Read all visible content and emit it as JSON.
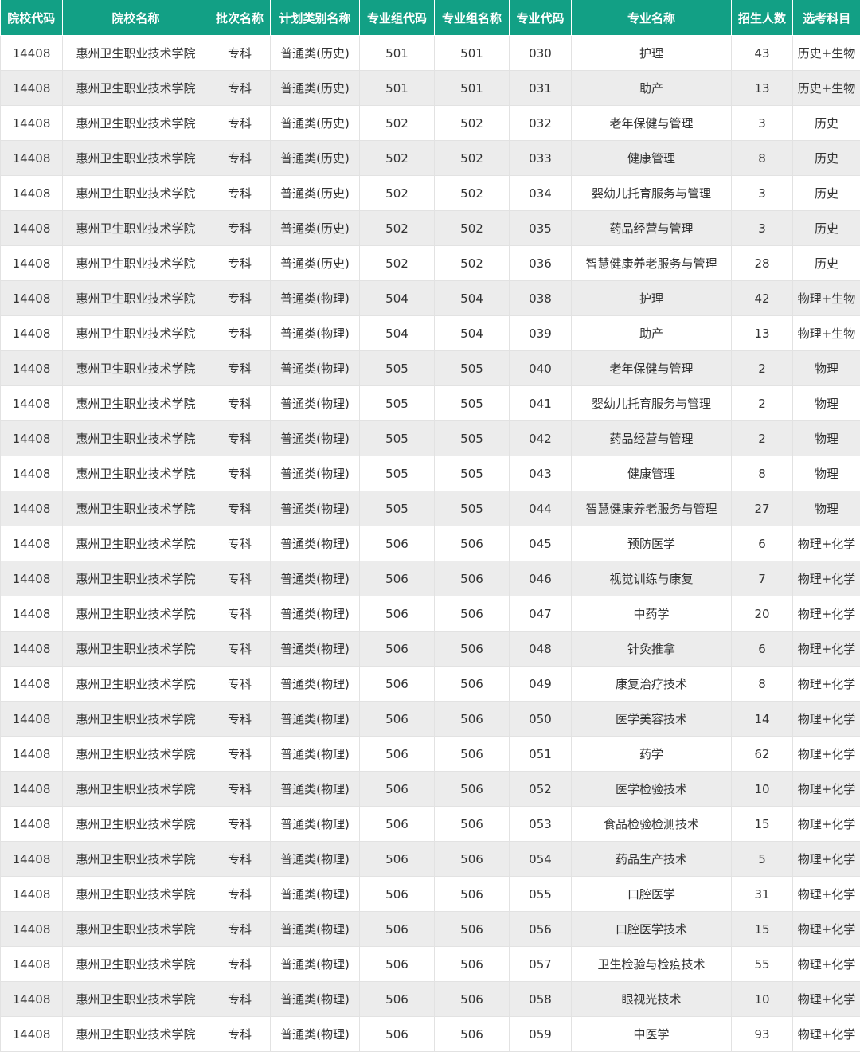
{
  "table": {
    "headers": [
      "院校代码",
      "院校名称",
      "批次名称",
      "计划类别名称",
      "专业组代码",
      "专业组名称",
      "专业代码",
      "专业名称",
      "招生人数",
      "选考科目"
    ],
    "rows": [
      [
        "14408",
        "惠州卫生职业技术学院",
        "专科",
        "普通类(历史)",
        "501",
        "501",
        "030",
        "护理",
        "43",
        "历史+生物"
      ],
      [
        "14408",
        "惠州卫生职业技术学院",
        "专科",
        "普通类(历史)",
        "501",
        "501",
        "031",
        "助产",
        "13",
        "历史+生物"
      ],
      [
        "14408",
        "惠州卫生职业技术学院",
        "专科",
        "普通类(历史)",
        "502",
        "502",
        "032",
        "老年保健与管理",
        "3",
        "历史"
      ],
      [
        "14408",
        "惠州卫生职业技术学院",
        "专科",
        "普通类(历史)",
        "502",
        "502",
        "033",
        "健康管理",
        "8",
        "历史"
      ],
      [
        "14408",
        "惠州卫生职业技术学院",
        "专科",
        "普通类(历史)",
        "502",
        "502",
        "034",
        "婴幼儿托育服务与管理",
        "3",
        "历史"
      ],
      [
        "14408",
        "惠州卫生职业技术学院",
        "专科",
        "普通类(历史)",
        "502",
        "502",
        "035",
        "药品经营与管理",
        "3",
        "历史"
      ],
      [
        "14408",
        "惠州卫生职业技术学院",
        "专科",
        "普通类(历史)",
        "502",
        "502",
        "036",
        "智慧健康养老服务与管理",
        "28",
        "历史"
      ],
      [
        "14408",
        "惠州卫生职业技术学院",
        "专科",
        "普通类(物理)",
        "504",
        "504",
        "038",
        "护理",
        "42",
        "物理+生物"
      ],
      [
        "14408",
        "惠州卫生职业技术学院",
        "专科",
        "普通类(物理)",
        "504",
        "504",
        "039",
        "助产",
        "13",
        "物理+生物"
      ],
      [
        "14408",
        "惠州卫生职业技术学院",
        "专科",
        "普通类(物理)",
        "505",
        "505",
        "040",
        "老年保健与管理",
        "2",
        "物理"
      ],
      [
        "14408",
        "惠州卫生职业技术学院",
        "专科",
        "普通类(物理)",
        "505",
        "505",
        "041",
        "婴幼儿托育服务与管理",
        "2",
        "物理"
      ],
      [
        "14408",
        "惠州卫生职业技术学院",
        "专科",
        "普通类(物理)",
        "505",
        "505",
        "042",
        "药品经营与管理",
        "2",
        "物理"
      ],
      [
        "14408",
        "惠州卫生职业技术学院",
        "专科",
        "普通类(物理)",
        "505",
        "505",
        "043",
        "健康管理",
        "8",
        "物理"
      ],
      [
        "14408",
        "惠州卫生职业技术学院",
        "专科",
        "普通类(物理)",
        "505",
        "505",
        "044",
        "智慧健康养老服务与管理",
        "27",
        "物理"
      ],
      [
        "14408",
        "惠州卫生职业技术学院",
        "专科",
        "普通类(物理)",
        "506",
        "506",
        "045",
        "预防医学",
        "6",
        "物理+化学"
      ],
      [
        "14408",
        "惠州卫生职业技术学院",
        "专科",
        "普通类(物理)",
        "506",
        "506",
        "046",
        "视觉训练与康复",
        "7",
        "物理+化学"
      ],
      [
        "14408",
        "惠州卫生职业技术学院",
        "专科",
        "普通类(物理)",
        "506",
        "506",
        "047",
        "中药学",
        "20",
        "物理+化学"
      ],
      [
        "14408",
        "惠州卫生职业技术学院",
        "专科",
        "普通类(物理)",
        "506",
        "506",
        "048",
        "针灸推拿",
        "6",
        "物理+化学"
      ],
      [
        "14408",
        "惠州卫生职业技术学院",
        "专科",
        "普通类(物理)",
        "506",
        "506",
        "049",
        "康复治疗技术",
        "8",
        "物理+化学"
      ],
      [
        "14408",
        "惠州卫生职业技术学院",
        "专科",
        "普通类(物理)",
        "506",
        "506",
        "050",
        "医学美容技术",
        "14",
        "物理+化学"
      ],
      [
        "14408",
        "惠州卫生职业技术学院",
        "专科",
        "普通类(物理)",
        "506",
        "506",
        "051",
        "药学",
        "62",
        "物理+化学"
      ],
      [
        "14408",
        "惠州卫生职业技术学院",
        "专科",
        "普通类(物理)",
        "506",
        "506",
        "052",
        "医学检验技术",
        "10",
        "物理+化学"
      ],
      [
        "14408",
        "惠州卫生职业技术学院",
        "专科",
        "普通类(物理)",
        "506",
        "506",
        "053",
        "食品检验检测技术",
        "15",
        "物理+化学"
      ],
      [
        "14408",
        "惠州卫生职业技术学院",
        "专科",
        "普通类(物理)",
        "506",
        "506",
        "054",
        "药品生产技术",
        "5",
        "物理+化学"
      ],
      [
        "14408",
        "惠州卫生职业技术学院",
        "专科",
        "普通类(物理)",
        "506",
        "506",
        "055",
        "口腔医学",
        "31",
        "物理+化学"
      ],
      [
        "14408",
        "惠州卫生职业技术学院",
        "专科",
        "普通类(物理)",
        "506",
        "506",
        "056",
        "口腔医学技术",
        "15",
        "物理+化学"
      ],
      [
        "14408",
        "惠州卫生职业技术学院",
        "专科",
        "普通类(物理)",
        "506",
        "506",
        "057",
        "卫生检验与检疫技术",
        "55",
        "物理+化学"
      ],
      [
        "14408",
        "惠州卫生职业技术学院",
        "专科",
        "普通类(物理)",
        "506",
        "506",
        "058",
        "眼视光技术",
        "10",
        "物理+化学"
      ],
      [
        "14408",
        "惠州卫生职业技术学院",
        "专科",
        "普通类(物理)",
        "506",
        "506",
        "059",
        "中医学",
        "93",
        "物理+化学"
      ]
    ]
  },
  "colors": {
    "header_bg": "#12a085",
    "header_text": "#ffffff",
    "row_alt_bg": "#ececec",
    "border": "#e2e2e2"
  }
}
